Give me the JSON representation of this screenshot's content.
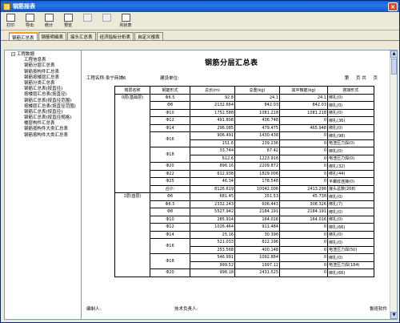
{
  "window": {
    "title": "钢筋报表",
    "close_label": "×"
  },
  "toolbar": {
    "buttons": [
      {
        "label": "打印",
        "enabled": true
      },
      {
        "label": "导出",
        "enabled": true
      },
      {
        "label": "统计",
        "enabled": true
      },
      {
        "label": "预览",
        "enabled": true
      },
      {
        "label": "",
        "enabled": false
      },
      {
        "label": "",
        "enabled": false
      },
      {
        "label": "列状表",
        "enabled": true
      }
    ]
  },
  "tabs": [
    "钢筋汇总表",
    "钢筋明细表",
    "接头汇总表",
    "经济指标分析表",
    "自定义报表"
  ],
  "tree": {
    "root": "工程数据",
    "items": [
      "工程信息表",
      "钢筋分层汇总表",
      "钢筋按构件汇总表",
      "钢筋按楼层汇总表",
      "钢筋分类汇总表",
      "钢筋汇总表(按直径)",
      "按楼层汇总表(按直径)",
      "钢筋汇总表(按直径范围)",
      "按楼层汇总表(按直径范围)",
      "钢筋汇总表(按直径)",
      "钢筋汇总表(按直径规格)",
      "楼层构件汇总表",
      "钢筋按构件大类汇总表",
      "钢筋按构件大类汇总表"
    ]
  },
  "report": {
    "title": "钢筋分层汇总表",
    "project_label": "工程名称:阜宁商铺6",
    "unit_label": "建设单位:",
    "page_label": "第",
    "page_mid": "页 共",
    "page_end": "页",
    "headers": [
      "楼层名称",
      "钢筋形式",
      "总长(m)",
      "总重(kg)",
      "其中箍筋(kg)",
      "搭接形式"
    ],
    "rows": [
      {
        "floor": "0层(基础层)",
        "form": "Φ6.5",
        "len": "92.8",
        "wt": "24.1",
        "stir": "24.1",
        "lap": "绑扎(0)"
      },
      {
        "floor": "",
        "form": "Φ8",
        "len": "2132.664",
        "wt": "842.03",
        "stir": "842.03",
        "lap": "绑扎(0)"
      },
      {
        "floor": "",
        "form": "Φ10",
        "len": "1752.588",
        "wt": "1081.218",
        "stir": "1081.218",
        "lap": "绑扎(0)"
      },
      {
        "floor": "",
        "form": "Φ12",
        "len": "491.808",
        "wt": "436.748",
        "stir": "0",
        "lap": "绑扎(36)"
      },
      {
        "floor": "",
        "form": "Φ14",
        "len": "296.085",
        "wt": "479.475",
        "stir": "465.948",
        "lap": "绑扎(0)"
      },
      {
        "floor": "",
        "form": "Φ16",
        "len": "906.491",
        "wt": "1430.438",
        "stir": "0",
        "lap": "绑扎(98)"
      },
      {
        "floor": "",
        "form": "",
        "len": "151.6",
        "wt": "239.236",
        "stir": "0",
        "lap": "电渣压力焊(0)"
      },
      {
        "floor": "",
        "form": "Φ18",
        "len": "33.744",
        "wt": "67.42",
        "stir": "0",
        "lap": "绑扎(0)"
      },
      {
        "floor": "",
        "form": "",
        "len": "612.6",
        "wt": "1223.916",
        "stir": "0",
        "lap": "电渣压力焊(0)"
      },
      {
        "floor": "",
        "form": "Φ20",
        "len": "896.16",
        "wt": "2209.872",
        "stir": "0",
        "lap": "绑扎(32)"
      },
      {
        "floor": "",
        "form": "Φ22",
        "len": "612.938",
        "wt": "1829.006",
        "stir": "0",
        "lap": "绑扎(44)"
      },
      {
        "floor": "",
        "form": "Φ25",
        "len": "46.34",
        "wt": "178.548",
        "stir": "0",
        "lap": "平螺纹连接(0)"
      },
      {
        "floor": "",
        "form": "合计:",
        "len": "8126.619",
        "wt": "10042.006",
        "stir": "2413.296",
        "lap": "接头总数(208)"
      },
      {
        "floor": "1层(首层)",
        "form": "Φ6",
        "len": "681.45",
        "wt": "151.53",
        "stir": "45.738",
        "lap": "绑扎(0)"
      },
      {
        "floor": "",
        "form": "Φ6.5",
        "len": "2332.243",
        "wt": "606.443",
        "stir": "308.326",
        "lap": "绑扎(7)"
      },
      {
        "floor": "",
        "form": "Φ8",
        "len": "5527.942",
        "wt": "2184.191",
        "stir": "2184.191",
        "lap": "绑扎(0)"
      },
      {
        "floor": "",
        "form": "Φ10",
        "len": "285.914",
        "wt": "164.016",
        "stir": "164.016",
        "lap": "绑扎(0)"
      },
      {
        "floor": "",
        "form": "Φ12",
        "len": "1026.464",
        "wt": "911.484",
        "stir": "0",
        "lap": "绑扎(66)"
      },
      {
        "floor": "",
        "form": "Φ14",
        "len": "25.16",
        "wt": "30.396",
        "stir": "0",
        "lap": "绑扎(0)"
      },
      {
        "floor": "",
        "form": "Φ16",
        "len": "521.033",
        "wt": "822.196",
        "stir": "0",
        "lap": "绑扎(0)"
      },
      {
        "floor": "",
        "form": "",
        "len": "253.568",
        "wt": "400.148",
        "stir": "0",
        "lap": "电渣压力焊(50)"
      },
      {
        "floor": "",
        "form": "Φ18",
        "len": "546.991",
        "wt": "1092.884",
        "stir": "0",
        "lap": "绑扎(0)"
      },
      {
        "floor": "",
        "form": "",
        "len": "999.52",
        "wt": "1997.12",
        "stir": "0",
        "lap": "电渣压力焊(184)"
      },
      {
        "floor": "",
        "form": "Φ20",
        "len": "998.18",
        "wt": "2431.525",
        "stir": "0",
        "lap": "绑扎(66)"
      }
    ],
    "footer": {
      "maker": "编制人:",
      "tech": "技术负责人:",
      "brand": "鲁班软件"
    }
  }
}
